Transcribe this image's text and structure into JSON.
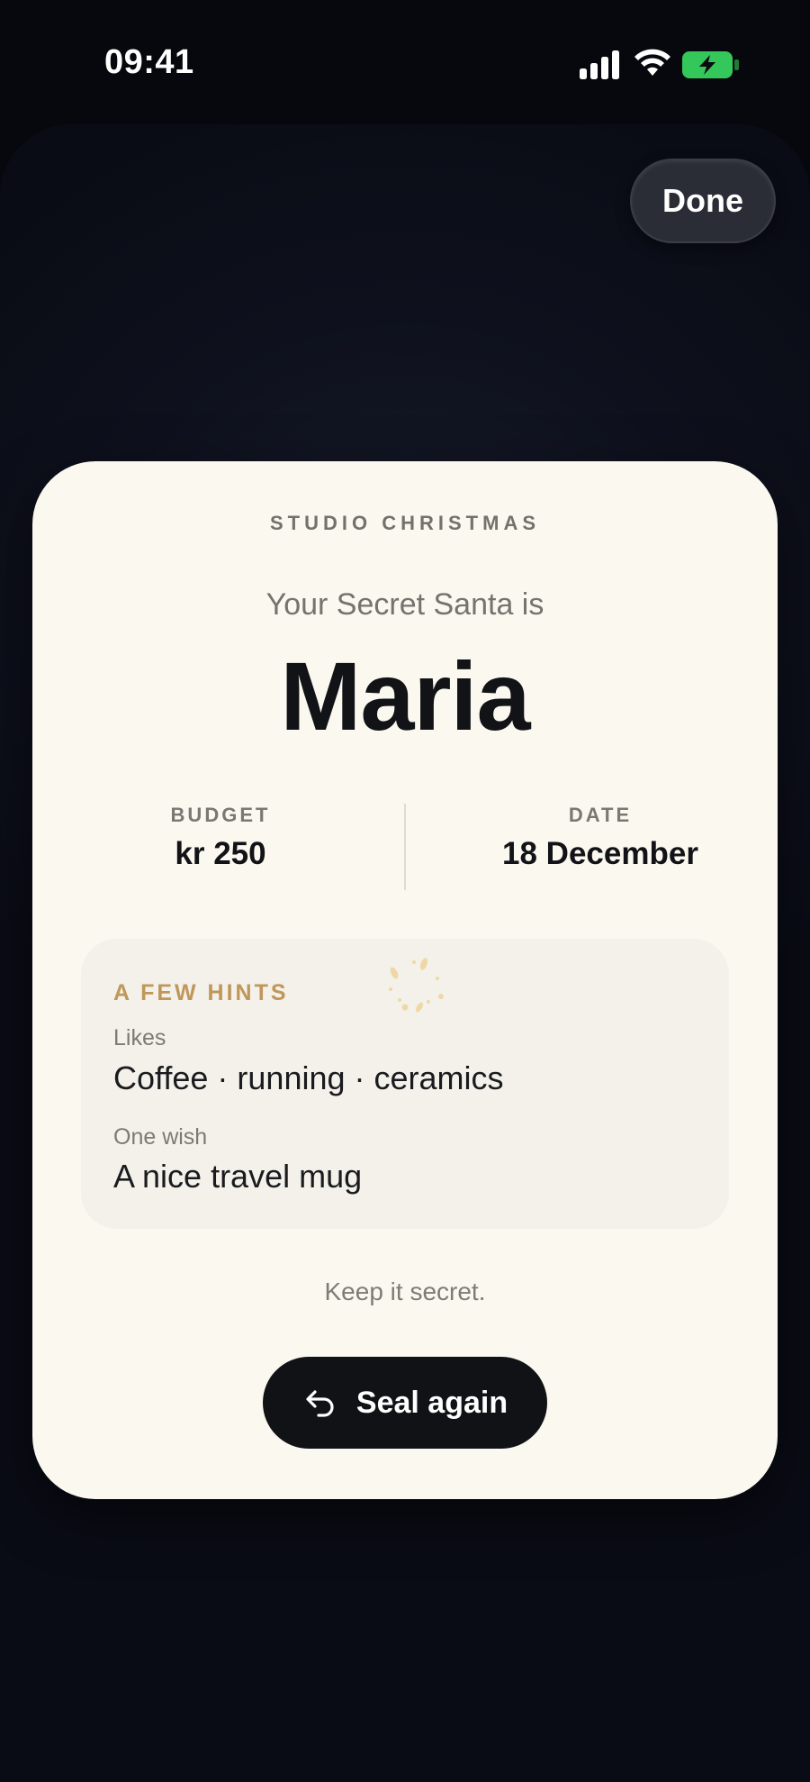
{
  "status_bar": {
    "time": "09:41",
    "icons": [
      "signal-icon",
      "wifi-icon",
      "battery-charging-icon"
    ],
    "battery_color": "#34c759"
  },
  "header": {
    "done_label": "Done"
  },
  "card": {
    "eyebrow": "STUDIO CHRISTMAS",
    "subtitle": "Your Secret Santa is",
    "name": "Maria",
    "budget": {
      "label": "BUDGET",
      "value": "kr 250"
    },
    "date": {
      "label": "DATE",
      "value": "18 December"
    },
    "hints": {
      "title": "A FEW HINTS",
      "accent_color": "#c0975a",
      "items": [
        {
          "label": "Likes",
          "value": "Coffee · running · ceramics"
        },
        {
          "label": "One wish",
          "value": "A nice travel mug"
        }
      ]
    },
    "footer_note": "Keep it secret.",
    "seal_button": {
      "label": "Seal again",
      "icon": "undo-arrow-icon"
    }
  }
}
